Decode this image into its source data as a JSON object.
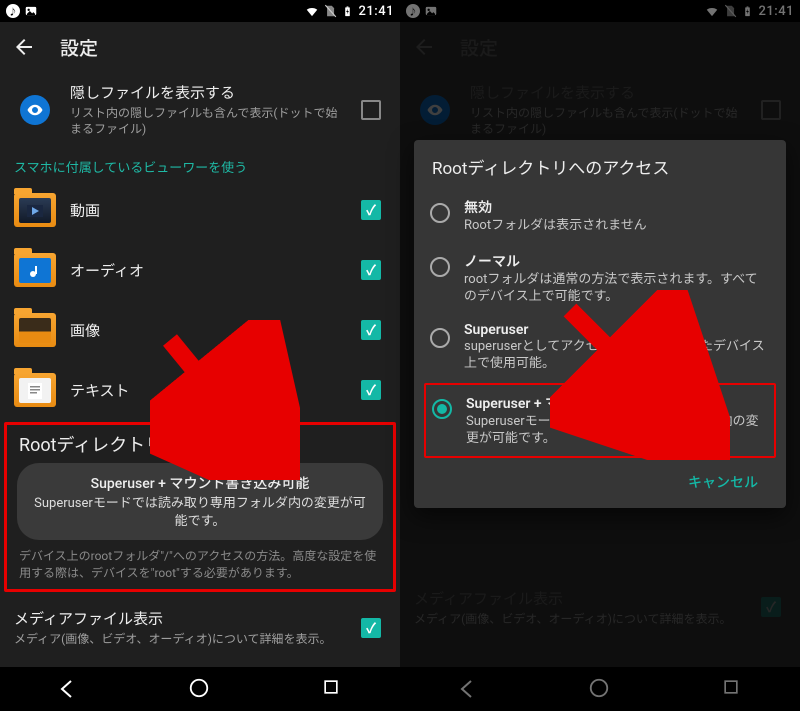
{
  "status": {
    "time": "21:41"
  },
  "appbar": {
    "title": "設定"
  },
  "hidden_files": {
    "title": "隠しファイルを表示する",
    "sub": "リスト内の隠しファイルも含んで表示(ドットで始まるファイル)"
  },
  "viewer_section": "スマホに付属しているビューワーを使う",
  "viewers": {
    "video": "動画",
    "audio": "オーディオ",
    "image": "画像",
    "text": "テキスト"
  },
  "root": {
    "heading": "Rootディレクトリへのアクセス",
    "toast_title": "Superuser + マウント書き込み可能",
    "toast_sub": "Superuserモードでは読み取り専用フォルダ内の変更が可能です。",
    "desc": "デバイス上のrootフォルダ\"/\"へのアクセスの方法。高度な設定を使用する際は、デバイスを\"root\"する必要があります。"
  },
  "media": {
    "title": "メディアファイル表示",
    "sub": "メディア(画像、ビデオ、オーディオ)について詳細を表示。"
  },
  "dialog": {
    "title": "Rootディレクトリへのアクセス",
    "opt1_title": "無効",
    "opt1_sub": "Rootフォルダは表示されません",
    "opt2_title": "ノーマル",
    "opt2_sub": "rootフォルダは通常の方法で表示されます。すべてのデバイス上で可能です。",
    "opt3_title": "Superuser",
    "opt3_sub": "superuserとしてアクセス可能。rootされたデバイス上で使用可能。",
    "opt4_title": "Superuser + マウント書き込み可能",
    "opt4_sub": "Superuserモードでは読み取り専用フォルダ内の変更が可能です。",
    "cancel": "キャンセル"
  }
}
